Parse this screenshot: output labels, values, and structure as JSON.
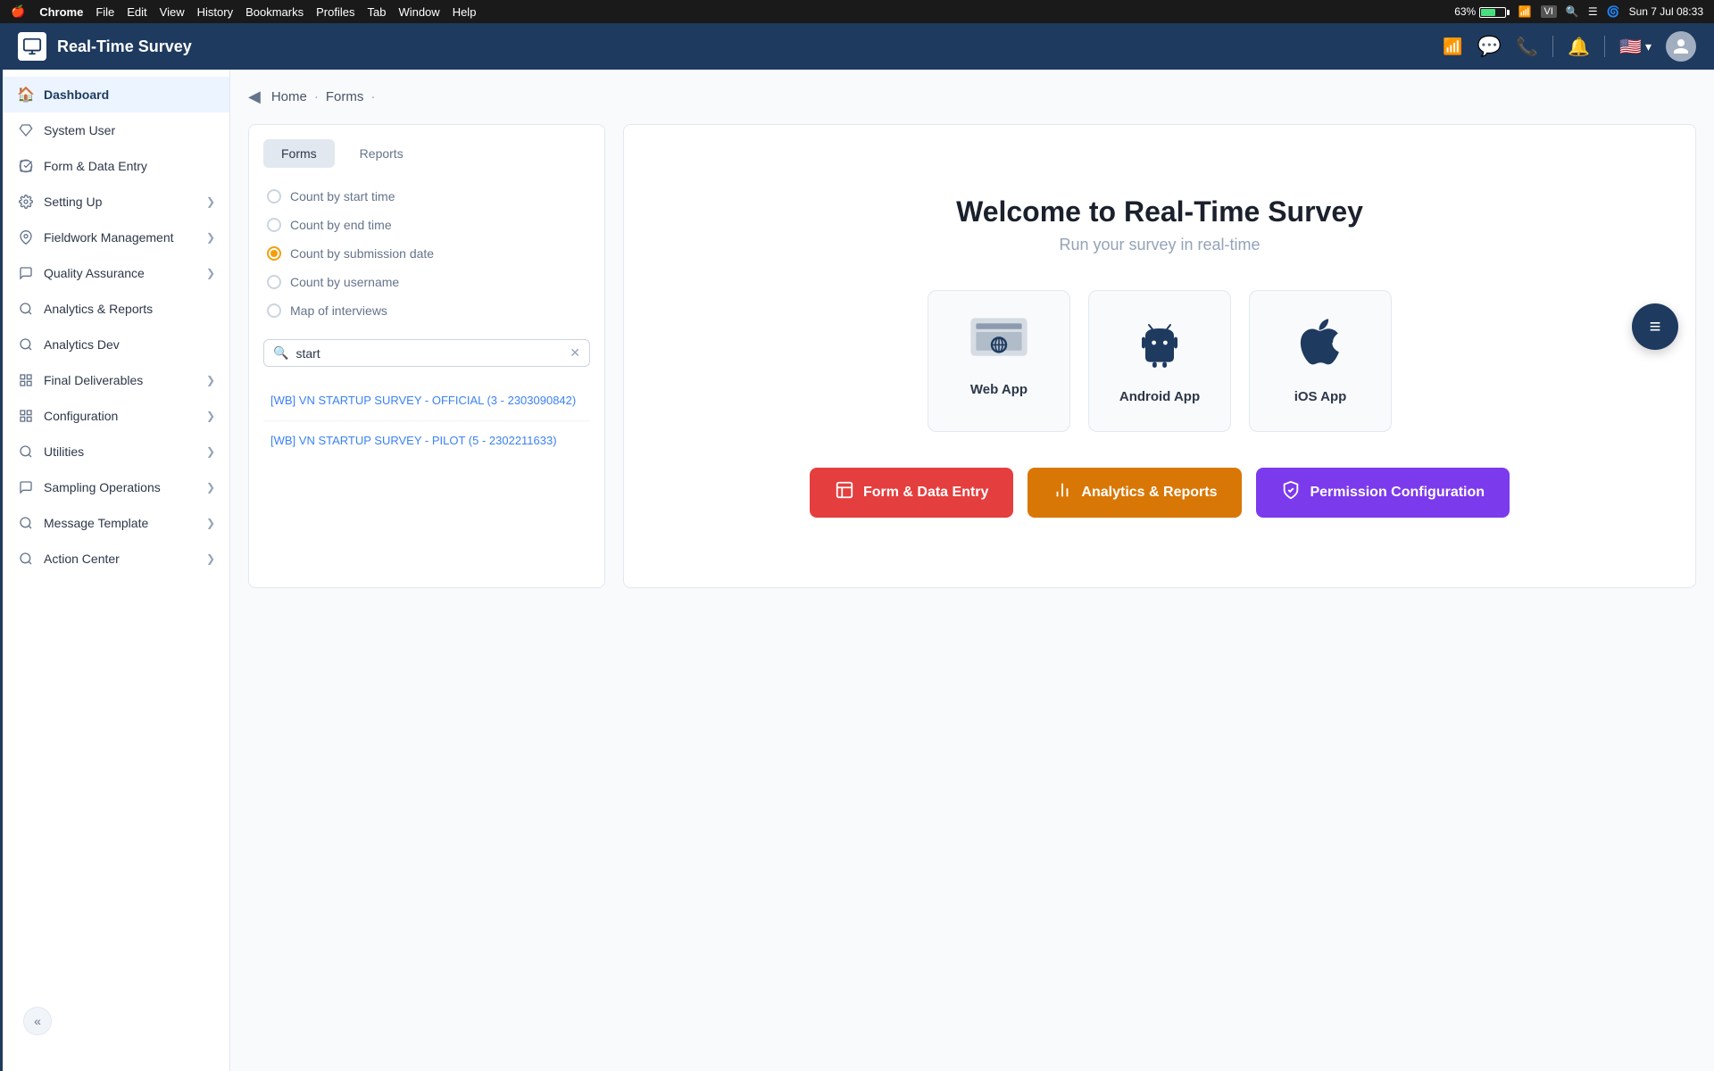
{
  "menubar": {
    "apple": "🍎",
    "items": [
      "Chrome",
      "File",
      "Edit",
      "View",
      "History",
      "Bookmarks",
      "Profiles",
      "Tab",
      "Window",
      "Help"
    ],
    "battery": "63%",
    "time": "Sun 7 Jul  08:33"
  },
  "titlebar": {
    "app_title": "Real-Time Survey"
  },
  "sidebar": {
    "items": [
      {
        "id": "dashboard",
        "label": "Dashboard",
        "icon": "🏠",
        "active": true,
        "has_arrow": false
      },
      {
        "id": "system-user",
        "label": "System User",
        "icon": "🔷",
        "active": false,
        "has_arrow": false
      },
      {
        "id": "form-data-entry",
        "label": "Form & Data Entry",
        "icon": "✅",
        "active": false,
        "has_arrow": false
      },
      {
        "id": "setting-up",
        "label": "Setting Up",
        "icon": "⚙️",
        "active": false,
        "has_arrow": true
      },
      {
        "id": "fieldwork",
        "label": "Fieldwork Management",
        "icon": "📍",
        "active": false,
        "has_arrow": true
      },
      {
        "id": "quality",
        "label": "Quality Assurance",
        "icon": "💬",
        "active": false,
        "has_arrow": true
      },
      {
        "id": "analytics",
        "label": "Analytics & Reports",
        "icon": "🔧",
        "active": false,
        "has_arrow": false
      },
      {
        "id": "analytics-dev",
        "label": "Analytics Dev",
        "icon": "🔧",
        "active": false,
        "has_arrow": false
      },
      {
        "id": "final-deliverables",
        "label": "Final Deliverables",
        "icon": "🎁",
        "active": false,
        "has_arrow": true
      },
      {
        "id": "configuration",
        "label": "Configuration",
        "icon": "⬛",
        "active": false,
        "has_arrow": true
      },
      {
        "id": "utilities",
        "label": "Utilities",
        "icon": "🔧",
        "active": false,
        "has_arrow": true
      },
      {
        "id": "sampling",
        "label": "Sampling Operations",
        "icon": "💬",
        "active": false,
        "has_arrow": true
      },
      {
        "id": "message",
        "label": "Message Template",
        "icon": "🔧",
        "active": false,
        "has_arrow": true
      },
      {
        "id": "action-center",
        "label": "Action Center",
        "icon": "🔧",
        "active": false,
        "has_arrow": true
      }
    ]
  },
  "breadcrumb": {
    "back_label": "◀",
    "items": [
      {
        "id": "home",
        "label": "Home"
      },
      {
        "id": "forms",
        "label": "Forms"
      }
    ]
  },
  "left_panel": {
    "tabs": [
      {
        "id": "forms",
        "label": "Forms",
        "active": true
      },
      {
        "id": "reports",
        "label": "Reports",
        "active": false
      }
    ],
    "radio_options": [
      {
        "id": "start-time",
        "label": "Count by start time",
        "checked": false
      },
      {
        "id": "end-time",
        "label": "Count by end time",
        "checked": false
      },
      {
        "id": "submission-date",
        "label": "Count by submission date",
        "checked": true
      },
      {
        "id": "username",
        "label": "Count by username",
        "checked": false
      },
      {
        "id": "map-interviews",
        "label": "Map of interviews",
        "checked": false
      }
    ],
    "search": {
      "placeholder": "start",
      "value": "start"
    },
    "surveys": [
      {
        "id": "survey-1",
        "label": "[WB] VN STARTUP SURVEY - OFFICIAL (3 - 2303090842)"
      },
      {
        "id": "survey-2",
        "label": "[WB] VN STARTUP SURVEY - PILOT (5 - 2302211633)"
      }
    ]
  },
  "right_panel": {
    "welcome_title": "Welcome to Real-Time Survey",
    "welcome_subtitle": "Run your survey in real-time",
    "app_cards": [
      {
        "id": "web-app",
        "label": "Web App"
      },
      {
        "id": "android-app",
        "label": "Android App"
      },
      {
        "id": "ios-app",
        "label": "iOS App"
      }
    ],
    "action_buttons": [
      {
        "id": "form-data-entry",
        "label": "Form & Data Entry",
        "color": "red"
      },
      {
        "id": "analytics-reports",
        "label": "Analytics & Reports",
        "color": "yellow"
      },
      {
        "id": "permission-config",
        "label": "Permission Configuration",
        "color": "purple"
      }
    ]
  },
  "fab": {
    "icon": "≡"
  },
  "collapse_btn": {
    "icon": "«"
  }
}
